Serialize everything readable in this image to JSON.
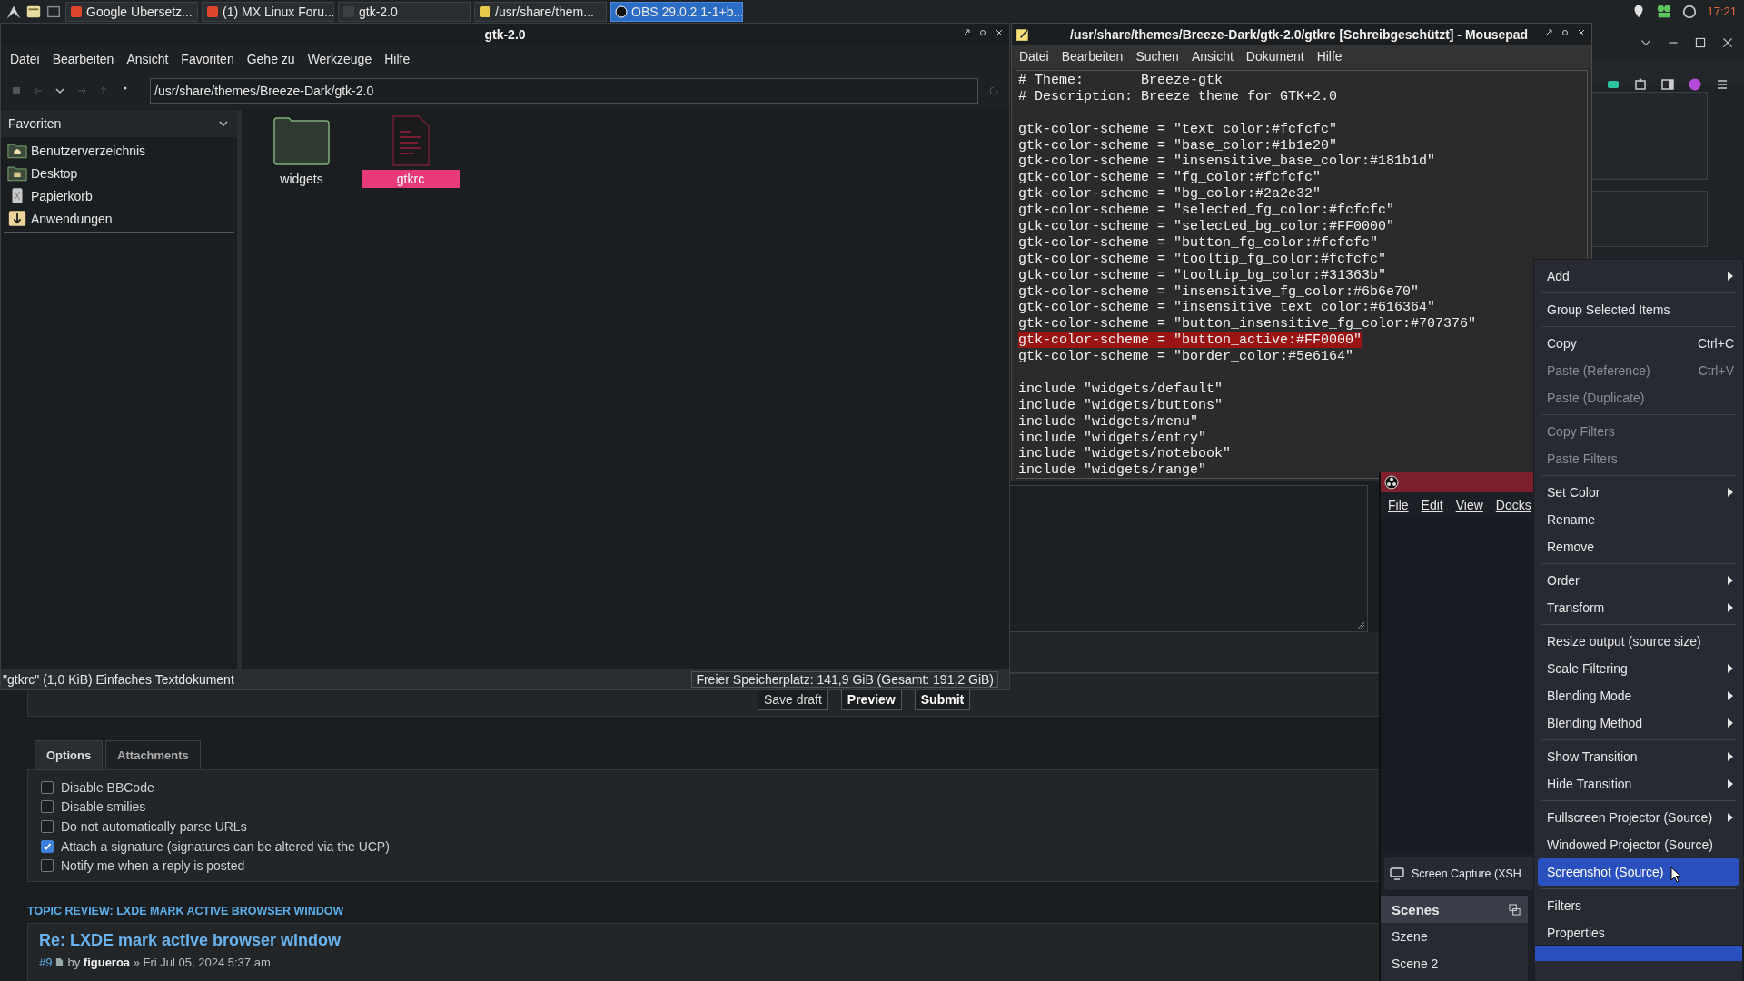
{
  "taskbar": {
    "tasks": [
      {
        "label": "Google Übersetz...",
        "kind": "browser",
        "selected": false
      },
      {
        "label": "(1) MX Linux Foru...",
        "kind": "browser",
        "selected": false
      },
      {
        "label": "gtk-2.0",
        "kind": "folder",
        "selected": false
      },
      {
        "label": "/usr/share/them...",
        "kind": "editor",
        "selected": false
      },
      {
        "label": "OBS 29.0.2.1-1+b...",
        "kind": "obs",
        "selected": true
      }
    ],
    "clock": "17:21"
  },
  "file_manager": {
    "title": "gtk-2.0",
    "menu": [
      "Datei",
      "Bearbeiten",
      "Ansicht",
      "Favoriten",
      "Gehe zu",
      "Werkzeuge",
      "Hilfe"
    ],
    "path": "/usr/share/themes/Breeze-Dark/gtk-2.0",
    "sidebar": {
      "title": "Favoriten",
      "items": [
        {
          "label": "Benutzerverzeichnis",
          "kind": "home"
        },
        {
          "label": "Desktop",
          "kind": "desktop"
        },
        {
          "label": "Papierkorb",
          "kind": "trash"
        },
        {
          "label": "Anwendungen",
          "kind": "apps"
        }
      ]
    },
    "files": [
      {
        "name": "widgets",
        "kind": "folder",
        "selected": false
      },
      {
        "name": "gtkrc",
        "kind": "text",
        "selected": true
      }
    ],
    "status_left": "\"gtkrc\" (1,0 KiB) Einfaches Textdokument",
    "status_right": "Freier Speicherplatz: 141,9 GiB (Gesamt: 191,2 GiB)"
  },
  "editor": {
    "title": "/usr/share/themes/Breeze-Dark/gtk-2.0/gtkrc [Schreibgeschützt] - Mousepad",
    "menu": [
      "Datei",
      "Bearbeiten",
      "Suchen",
      "Ansicht",
      "Dokument",
      "Hilfe"
    ],
    "blocks": [
      {
        "lines": [
          {
            "text": "# Theme:       Breeze-gtk",
            "selected": false
          },
          {
            "text": "# Description: Breeze theme for GTK+2.0",
            "selected": false
          }
        ]
      },
      {
        "lines": [
          {
            "text": "gtk-color-scheme = \"text_color:#fcfcfc\"",
            "selected": false
          },
          {
            "text": "gtk-color-scheme = \"base_color:#1b1e20\"",
            "selected": false
          },
          {
            "text": "gtk-color-scheme = \"insensitive_base_color:#181b1d\"",
            "selected": false
          },
          {
            "text": "gtk-color-scheme = \"fg_color:#fcfcfc\"",
            "selected": false
          },
          {
            "text": "gtk-color-scheme = \"bg_color:#2a2e32\"",
            "selected": false
          },
          {
            "text": "gtk-color-scheme = \"selected_fg_color:#fcfcfc\"",
            "selected": false
          },
          {
            "text": "gtk-color-scheme = \"selected_bg_color:#FF0000\"",
            "selected": false
          },
          {
            "text": "gtk-color-scheme = \"button_fg_color:#fcfcfc\"",
            "selected": false
          },
          {
            "text": "gtk-color-scheme = \"tooltip_fg_color:#fcfcfc\"",
            "selected": false
          },
          {
            "text": "gtk-color-scheme = \"tooltip_bg_color:#31363b\"",
            "selected": false
          },
          {
            "text": "gtk-color-scheme = \"insensitive_fg_color:#6b6e70\"",
            "selected": false
          },
          {
            "text": "gtk-color-scheme = \"insensitive_text_color:#616364\"",
            "selected": false
          },
          {
            "text": "gtk-color-scheme = \"button_insensitive_fg_color:#707376\"",
            "selected": false
          },
          {
            "text": "gtk-color-scheme = \"button_active:#FF0000\"",
            "selected": true
          },
          {
            "text": "gtk-color-scheme = \"border_color:#5e6164\"",
            "selected": false
          }
        ]
      },
      {
        "lines": [
          {
            "text": "include \"widgets/default\"",
            "selected": false
          },
          {
            "text": "include \"widgets/buttons\"",
            "selected": false
          },
          {
            "text": "include \"widgets/menu\"",
            "selected": false
          },
          {
            "text": "include \"widgets/entry\"",
            "selected": false
          },
          {
            "text": "include \"widgets/notebook\"",
            "selected": false
          },
          {
            "text": "include \"widgets/range\"",
            "selected": false
          }
        ]
      }
    ]
  },
  "forum": {
    "buttons": [
      "Save draft",
      "Preview",
      "Submit"
    ],
    "tabs": [
      {
        "label": "Options",
        "selected": true
      },
      {
        "label": "Attachments",
        "selected": false
      }
    ],
    "options": [
      {
        "label": "Disable BBCode",
        "checked": false
      },
      {
        "label": "Disable smilies",
        "checked": false
      },
      {
        "label": "Do not automatically parse URLs",
        "checked": false
      },
      {
        "label": "Attach a signature (signatures can be altered via the UCP)",
        "checked": true
      },
      {
        "label": "Notify me when a reply is posted",
        "checked": false
      }
    ],
    "topic_review": "TOPIC REVIEW: LXDE MARK ACTIVE BROWSER WINDOW",
    "post_title": "Re: LXDE mark active browser window",
    "post_number": "#9",
    "post_byline": "by **figueroa** » Fri Jul 05, 2024 5:37 am"
  },
  "obs": {
    "menu": [
      "File",
      "Edit",
      "View",
      "Docks"
    ],
    "source": "Screen Capture (XSH",
    "scenes_title": "Scenes",
    "scenes": [
      {
        "label": "Szene",
        "selected": false
      },
      {
        "label": "Scene 2",
        "selected": false
      }
    ]
  },
  "context_menu": {
    "items": [
      {
        "kind": "item",
        "label": "Add",
        "submenu": true,
        "disabled": false,
        "selected": false
      },
      {
        "kind": "separator"
      },
      {
        "kind": "item",
        "label": "Group Selected Items",
        "submenu": false,
        "disabled": false,
        "selected": false
      },
      {
        "kind": "separator"
      },
      {
        "kind": "item",
        "label": "Copy",
        "shortcut": "Ctrl+C",
        "submenu": false,
        "disabled": false,
        "selected": false
      },
      {
        "kind": "item",
        "label": "Paste (Reference)",
        "shortcut": "Ctrl+V",
        "submenu": false,
        "disabled": true,
        "selected": false
      },
      {
        "kind": "item",
        "label": "Paste (Duplicate)",
        "submenu": false,
        "disabled": true,
        "selected": false
      },
      {
        "kind": "separator"
      },
      {
        "kind": "item",
        "label": "Copy Filters",
        "submenu": false,
        "disabled": true,
        "selected": false
      },
      {
        "kind": "item",
        "label": "Paste Filters",
        "submenu": false,
        "disabled": true,
        "selected": false
      },
      {
        "kind": "separator"
      },
      {
        "kind": "item",
        "label": "Set Color",
        "submenu": true,
        "disabled": false,
        "selected": false
      },
      {
        "kind": "item",
        "label": "Rename",
        "submenu": false,
        "disabled": false,
        "selected": false
      },
      {
        "kind": "item",
        "label": "Remove",
        "submenu": false,
        "disabled": false,
        "selected": false
      },
      {
        "kind": "separator"
      },
      {
        "kind": "item",
        "label": "Order",
        "submenu": true,
        "disabled": false,
        "selected": false
      },
      {
        "kind": "item",
        "label": "Transform",
        "submenu": true,
        "disabled": false,
        "selected": false
      },
      {
        "kind": "separator"
      },
      {
        "kind": "item",
        "label": "Resize output (source size)",
        "submenu": false,
        "disabled": false,
        "selected": false
      },
      {
        "kind": "item",
        "label": "Scale Filtering",
        "submenu": true,
        "disabled": false,
        "selected": false
      },
      {
        "kind": "item",
        "label": "Blending Mode",
        "submenu": true,
        "disabled": false,
        "selected": false
      },
      {
        "kind": "item",
        "label": "Blending Method",
        "submenu": true,
        "disabled": false,
        "selected": false
      },
      {
        "kind": "separator"
      },
      {
        "kind": "item",
        "label": "Show Transition",
        "submenu": true,
        "disabled": false,
        "selected": false
      },
      {
        "kind": "item",
        "label": "Hide Transition",
        "submenu": true,
        "disabled": false,
        "selected": false
      },
      {
        "kind": "separator"
      },
      {
        "kind": "item",
        "label": "Fullscreen Projector (Source)",
        "submenu": true,
        "disabled": false,
        "selected": false
      },
      {
        "kind": "item",
        "label": "Windowed Projector (Source)",
        "submenu": false,
        "disabled": false,
        "selected": false
      },
      {
        "kind": "item",
        "label": "Screenshot (Source)",
        "submenu": false,
        "disabled": false,
        "selected": true
      },
      {
        "kind": "separator"
      },
      {
        "kind": "item",
        "label": "Filters",
        "submenu": false,
        "disabled": false,
        "selected": false
      },
      {
        "kind": "item",
        "label": "Properties",
        "submenu": false,
        "disabled": false,
        "selected": false
      }
    ]
  }
}
